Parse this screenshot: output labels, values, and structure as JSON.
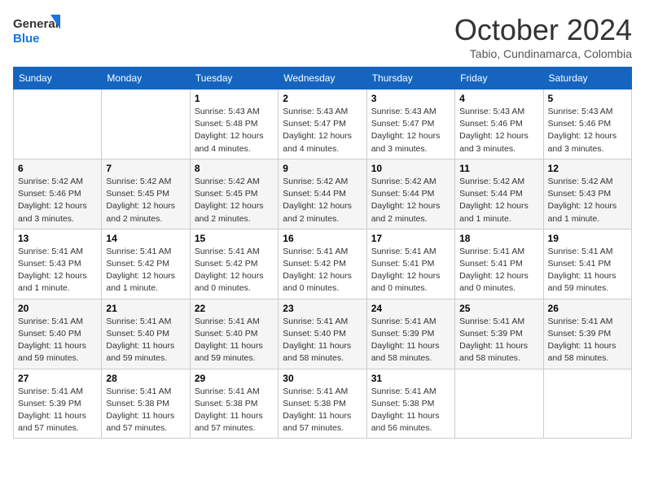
{
  "logo": {
    "line1": "General",
    "line2": "Blue"
  },
  "title": "October 2024",
  "subtitle": "Tabio, Cundinamarca, Colombia",
  "days_of_week": [
    "Sunday",
    "Monday",
    "Tuesday",
    "Wednesday",
    "Thursday",
    "Friday",
    "Saturday"
  ],
  "weeks": [
    [
      {
        "day": "",
        "info": ""
      },
      {
        "day": "",
        "info": ""
      },
      {
        "day": "1",
        "info": "Sunrise: 5:43 AM\nSunset: 5:48 PM\nDaylight: 12 hours and 4 minutes."
      },
      {
        "day": "2",
        "info": "Sunrise: 5:43 AM\nSunset: 5:47 PM\nDaylight: 12 hours and 4 minutes."
      },
      {
        "day": "3",
        "info": "Sunrise: 5:43 AM\nSunset: 5:47 PM\nDaylight: 12 hours and 3 minutes."
      },
      {
        "day": "4",
        "info": "Sunrise: 5:43 AM\nSunset: 5:46 PM\nDaylight: 12 hours and 3 minutes."
      },
      {
        "day": "5",
        "info": "Sunrise: 5:43 AM\nSunset: 5:46 PM\nDaylight: 12 hours and 3 minutes."
      }
    ],
    [
      {
        "day": "6",
        "info": "Sunrise: 5:42 AM\nSunset: 5:46 PM\nDaylight: 12 hours and 3 minutes."
      },
      {
        "day": "7",
        "info": "Sunrise: 5:42 AM\nSunset: 5:45 PM\nDaylight: 12 hours and 2 minutes."
      },
      {
        "day": "8",
        "info": "Sunrise: 5:42 AM\nSunset: 5:45 PM\nDaylight: 12 hours and 2 minutes."
      },
      {
        "day": "9",
        "info": "Sunrise: 5:42 AM\nSunset: 5:44 PM\nDaylight: 12 hours and 2 minutes."
      },
      {
        "day": "10",
        "info": "Sunrise: 5:42 AM\nSunset: 5:44 PM\nDaylight: 12 hours and 2 minutes."
      },
      {
        "day": "11",
        "info": "Sunrise: 5:42 AM\nSunset: 5:44 PM\nDaylight: 12 hours and 1 minute."
      },
      {
        "day": "12",
        "info": "Sunrise: 5:42 AM\nSunset: 5:43 PM\nDaylight: 12 hours and 1 minute."
      }
    ],
    [
      {
        "day": "13",
        "info": "Sunrise: 5:41 AM\nSunset: 5:43 PM\nDaylight: 12 hours and 1 minute."
      },
      {
        "day": "14",
        "info": "Sunrise: 5:41 AM\nSunset: 5:42 PM\nDaylight: 12 hours and 1 minute."
      },
      {
        "day": "15",
        "info": "Sunrise: 5:41 AM\nSunset: 5:42 PM\nDaylight: 12 hours and 0 minutes."
      },
      {
        "day": "16",
        "info": "Sunrise: 5:41 AM\nSunset: 5:42 PM\nDaylight: 12 hours and 0 minutes."
      },
      {
        "day": "17",
        "info": "Sunrise: 5:41 AM\nSunset: 5:41 PM\nDaylight: 12 hours and 0 minutes."
      },
      {
        "day": "18",
        "info": "Sunrise: 5:41 AM\nSunset: 5:41 PM\nDaylight: 12 hours and 0 minutes."
      },
      {
        "day": "19",
        "info": "Sunrise: 5:41 AM\nSunset: 5:41 PM\nDaylight: 11 hours and 59 minutes."
      }
    ],
    [
      {
        "day": "20",
        "info": "Sunrise: 5:41 AM\nSunset: 5:40 PM\nDaylight: 11 hours and 59 minutes."
      },
      {
        "day": "21",
        "info": "Sunrise: 5:41 AM\nSunset: 5:40 PM\nDaylight: 11 hours and 59 minutes."
      },
      {
        "day": "22",
        "info": "Sunrise: 5:41 AM\nSunset: 5:40 PM\nDaylight: 11 hours and 59 minutes."
      },
      {
        "day": "23",
        "info": "Sunrise: 5:41 AM\nSunset: 5:40 PM\nDaylight: 11 hours and 58 minutes."
      },
      {
        "day": "24",
        "info": "Sunrise: 5:41 AM\nSunset: 5:39 PM\nDaylight: 11 hours and 58 minutes."
      },
      {
        "day": "25",
        "info": "Sunrise: 5:41 AM\nSunset: 5:39 PM\nDaylight: 11 hours and 58 minutes."
      },
      {
        "day": "26",
        "info": "Sunrise: 5:41 AM\nSunset: 5:39 PM\nDaylight: 11 hours and 58 minutes."
      }
    ],
    [
      {
        "day": "27",
        "info": "Sunrise: 5:41 AM\nSunset: 5:39 PM\nDaylight: 11 hours and 57 minutes."
      },
      {
        "day": "28",
        "info": "Sunrise: 5:41 AM\nSunset: 5:38 PM\nDaylight: 11 hours and 57 minutes."
      },
      {
        "day": "29",
        "info": "Sunrise: 5:41 AM\nSunset: 5:38 PM\nDaylight: 11 hours and 57 minutes."
      },
      {
        "day": "30",
        "info": "Sunrise: 5:41 AM\nSunset: 5:38 PM\nDaylight: 11 hours and 57 minutes."
      },
      {
        "day": "31",
        "info": "Sunrise: 5:41 AM\nSunset: 5:38 PM\nDaylight: 11 hours and 56 minutes."
      },
      {
        "day": "",
        "info": ""
      },
      {
        "day": "",
        "info": ""
      }
    ]
  ]
}
